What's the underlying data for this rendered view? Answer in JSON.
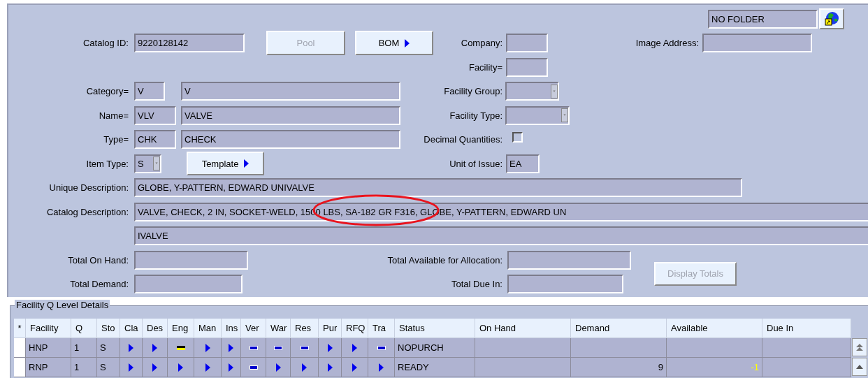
{
  "folder": {
    "value": "NO FOLDER"
  },
  "catalog_id": {
    "label": "Catalog ID:",
    "value": "9220128142"
  },
  "pool_button": {
    "label": "Pool",
    "disabled": true
  },
  "bom_button": {
    "label": "BOM",
    "disabled": false
  },
  "company": {
    "label": "Company:"
  },
  "image_address": {
    "label": "Image Address:"
  },
  "facility": {
    "label": "Facility="
  },
  "category": {
    "label": "Category=",
    "code": "V",
    "text": "V"
  },
  "facility_group": {
    "label": "Facility Group:"
  },
  "name": {
    "label": "Name=",
    "code": "VLV",
    "text": "VALVE"
  },
  "facility_type": {
    "label": "Facility Type:"
  },
  "type": {
    "label": "Type=",
    "code": "CHK",
    "text": "CHECK"
  },
  "decimal_quantities": {
    "label": "Decimal Quantities:",
    "checked": false
  },
  "item_type": {
    "label": "Item Type:",
    "value": "S"
  },
  "template_button": {
    "label": "Template",
    "disabled": false
  },
  "unit_of_issue": {
    "label": "Unit of Issue:",
    "value": "EA"
  },
  "unique_description": {
    "label": "Unique Description:",
    "value": "GLOBE, Y-PATTERN, EDWARD UNIVALVE"
  },
  "catalog_description": {
    "label": "Catalog Description:",
    "lines": [
      "VALVE, CHECK, 2 IN, SOCKET-WELD, 1500 LBS, SA-182 GR F316, GLOBE, Y-PATTERN, EDWARD UN",
      "IVALVE"
    ]
  },
  "total_on_hand": {
    "label": "Total On Hand:"
  },
  "total_available": {
    "label": "Total Available for Allocation:"
  },
  "total_demand": {
    "label": "Total Demand:"
  },
  "total_due_in": {
    "label": "Total Due In:"
  },
  "display_totals_button": {
    "label": "Display Totals",
    "disabled": true
  },
  "details": {
    "title": "Facility Q Level Details",
    "columns": [
      "*",
      "Facility",
      "Q",
      "Sto",
      "Cla",
      "Des",
      "Eng",
      "Man",
      "Ins",
      "Ver",
      "War",
      "Res",
      "Pur",
      "RFQ",
      "Tra",
      "Status",
      "On Hand",
      "Demand",
      "Available",
      "Due In"
    ],
    "rows": [
      {
        "facility": "HNP",
        "q": "1",
        "sto": "S",
        "indicators": [
          {
            "kind": "arrow"
          },
          {
            "kind": "arrow"
          },
          {
            "kind": "flag"
          },
          {
            "kind": "arrow"
          },
          {
            "kind": "arrow"
          },
          {
            "kind": "dash"
          },
          {
            "kind": "dash"
          },
          {
            "kind": "dash"
          },
          {
            "kind": "arrow"
          },
          {
            "kind": "arrow"
          },
          {
            "kind": "dash"
          }
        ],
        "status": "NOPURCH"
      },
      {
        "facility": "RNP",
        "q": "1",
        "sto": "S",
        "indicators": [
          {
            "kind": "arrow"
          },
          {
            "kind": "arrow"
          },
          {
            "kind": "arrow"
          },
          {
            "kind": "arrow"
          },
          {
            "kind": "arrow"
          },
          {
            "kind": "dash"
          },
          {
            "kind": "arrow"
          },
          {
            "kind": "arrow"
          },
          {
            "kind": "arrow"
          },
          {
            "kind": "arrow"
          },
          {
            "kind": "arrow"
          }
        ],
        "status": "READY",
        "demand": "9",
        "available": {
          "text": "-1",
          "warning": true
        }
      }
    ]
  }
}
